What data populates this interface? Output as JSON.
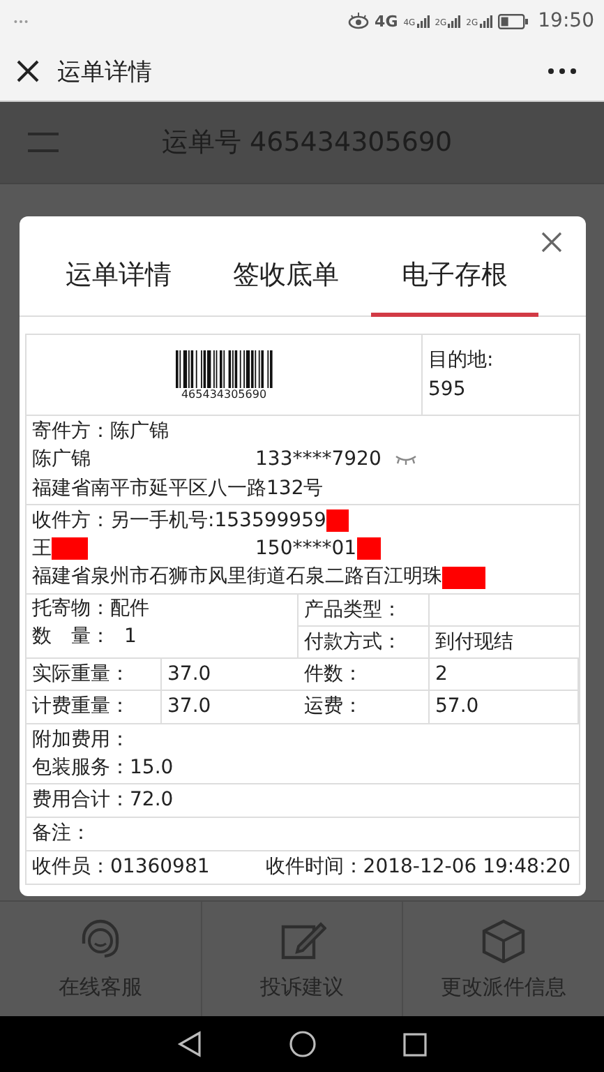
{
  "status_bar": {
    "network": "4G",
    "signal_labels": [
      "4G",
      "2G",
      "2G"
    ],
    "time": "19:50"
  },
  "app_bar": {
    "title": "运单详情"
  },
  "page": {
    "header": "运单号 465434305690"
  },
  "dialog": {
    "tabs": [
      {
        "label": "运单详情",
        "selected": false
      },
      {
        "label": "签收底单",
        "selected": false
      },
      {
        "label": "电子存根",
        "selected": true
      }
    ],
    "barcode_number": "465434305690",
    "destination_label": "目的地:",
    "destination": "595",
    "sender": {
      "heading": "寄件方：陈广锦",
      "name": "陈广锦",
      "phone": "133****7920",
      "address": "福建省南平市延平区八一路132号"
    },
    "receiver": {
      "heading": "收件方：另一手机号:153599959",
      "name": "王",
      "phone": "150****01",
      "address": "福建省泉州市石狮市风里街道石泉二路百江明珠",
      "redacted": true
    },
    "goods": "托寄物：配件",
    "quantity_label": "数　量：",
    "quantity": "1",
    "product_type_label": "产品类型：",
    "payment_label": "付款方式：",
    "payment": "到付现结",
    "weights": [
      {
        "label": "实际重量：",
        "value": "37.0",
        "label2": "件数：",
        "value2": "2"
      },
      {
        "label": "计费重量：",
        "value": "37.0",
        "label2": "运费：",
        "value2": "57.0"
      }
    ],
    "extra_fee_label": "附加费用：",
    "packaging": "包装服务：15.0",
    "total": "费用合计：72.0",
    "remark": "备注：",
    "collector": "收件员：01360981",
    "collect_time": "收件时间：2018-12-06 19:48:20"
  },
  "bottom_actions": [
    {
      "kind": "support",
      "label": "在线客服"
    },
    {
      "kind": "complaint",
      "label": "投诉建议"
    },
    {
      "kind": "change",
      "label": "更改派件信息"
    }
  ]
}
